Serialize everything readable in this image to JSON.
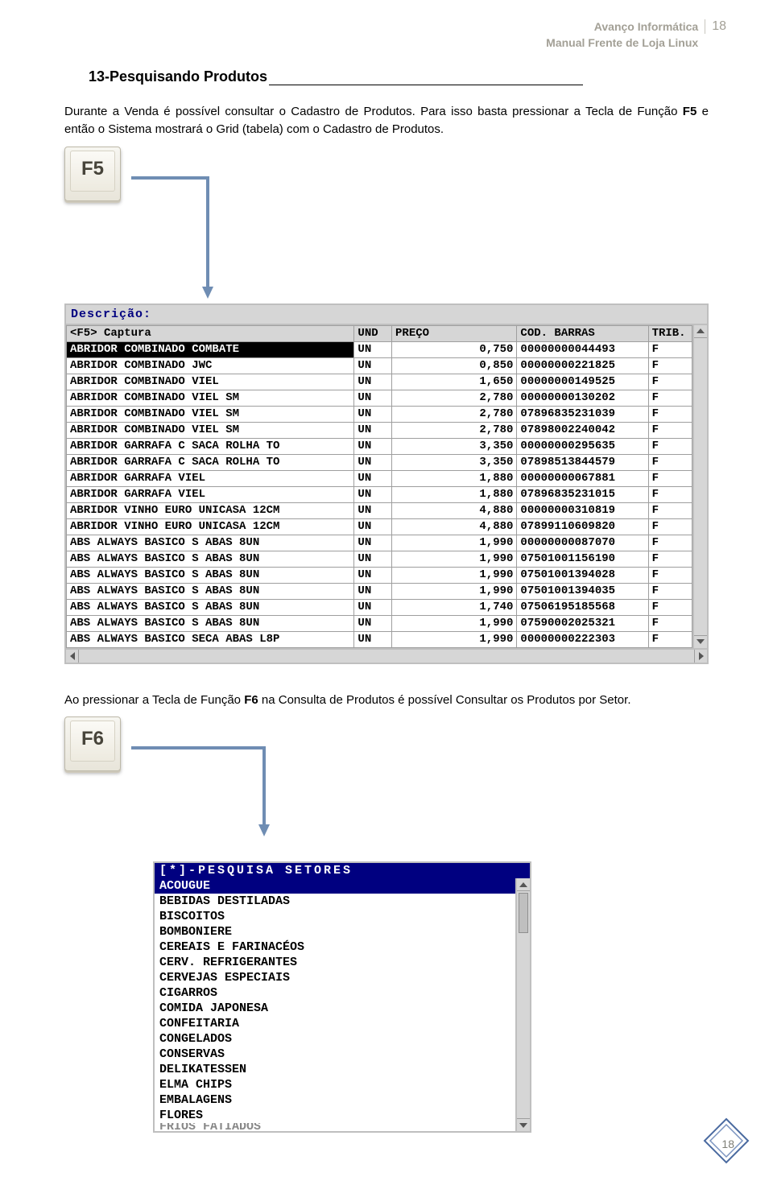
{
  "header": {
    "line1": "Avanço Informática",
    "line2": "Manual Frente de Loja Linux",
    "pagenum_top": "18"
  },
  "section": {
    "num": "13-",
    "title": "Pesquisando Produtos"
  },
  "para1_a": "Durante a Venda é possível consultar o Cadastro de Produtos. Para isso basta pressionar a Tecla de Função ",
  "para1_b": "F5",
  "para1_c": " e então o Sistema mostrará o Grid (tabela) com o Cadastro de Produtos.",
  "key1_label": "F5",
  "grid": {
    "desc_label": "Descrição:",
    "headers": {
      "capture": "<F5> Captura",
      "und": "UND",
      "preco": "PREÇO",
      "barras": "COD. BARRAS",
      "trib": "TRIB."
    },
    "rows": [
      {
        "desc": "ABRIDOR COMBINADO COMBATE",
        "und": "UN",
        "preco": "0,750",
        "barras": "00000000044493",
        "trib": "F"
      },
      {
        "desc": "ABRIDOR COMBINADO JWC",
        "und": "UN",
        "preco": "0,850",
        "barras": "00000000221825",
        "trib": "F"
      },
      {
        "desc": "ABRIDOR COMBINADO VIEL",
        "und": "UN",
        "preco": "1,650",
        "barras": "00000000149525",
        "trib": "F"
      },
      {
        "desc": "ABRIDOR COMBINADO VIEL SM",
        "und": "UN",
        "preco": "2,780",
        "barras": "00000000130202",
        "trib": "F"
      },
      {
        "desc": "ABRIDOR COMBINADO VIEL SM",
        "und": "UN",
        "preco": "2,780",
        "barras": "07896835231039",
        "trib": "F"
      },
      {
        "desc": "ABRIDOR COMBINADO VIEL SM",
        "und": "UN",
        "preco": "2,780",
        "barras": "07898002240042",
        "trib": "F"
      },
      {
        "desc": "ABRIDOR GARRAFA C SACA ROLHA TO",
        "und": "UN",
        "preco": "3,350",
        "barras": "00000000295635",
        "trib": "F"
      },
      {
        "desc": "ABRIDOR GARRAFA C SACA ROLHA TO",
        "und": "UN",
        "preco": "3,350",
        "barras": "07898513844579",
        "trib": "F"
      },
      {
        "desc": "ABRIDOR GARRAFA VIEL",
        "und": "UN",
        "preco": "1,880",
        "barras": "00000000067881",
        "trib": "F"
      },
      {
        "desc": "ABRIDOR GARRAFA VIEL",
        "und": "UN",
        "preco": "1,880",
        "barras": "07896835231015",
        "trib": "F"
      },
      {
        "desc": "ABRIDOR VINHO EURO UNICASA 12CM",
        "und": "UN",
        "preco": "4,880",
        "barras": "00000000310819",
        "trib": "F"
      },
      {
        "desc": "ABRIDOR VINHO EURO UNICASA 12CM",
        "und": "UN",
        "preco": "4,880",
        "barras": "07899110609820",
        "trib": "F"
      },
      {
        "desc": "ABS ALWAYS BASICO S ABAS 8UN",
        "und": "UN",
        "preco": "1,990",
        "barras": "00000000087070",
        "trib": "F"
      },
      {
        "desc": "ABS ALWAYS BASICO S ABAS 8UN",
        "und": "UN",
        "preco": "1,990",
        "barras": "07501001156190",
        "trib": "F"
      },
      {
        "desc": "ABS ALWAYS BASICO S ABAS 8UN",
        "und": "UN",
        "preco": "1,990",
        "barras": "07501001394028",
        "trib": "F"
      },
      {
        "desc": "ABS ALWAYS BASICO S ABAS 8UN",
        "und": "UN",
        "preco": "1,990",
        "barras": "07501001394035",
        "trib": "F"
      },
      {
        "desc": "ABS ALWAYS BASICO S ABAS 8UN",
        "und": "UN",
        "preco": "1,740",
        "barras": "07506195185568",
        "trib": "F"
      },
      {
        "desc": "ABS ALWAYS BASICO S ABAS 8UN",
        "und": "UN",
        "preco": "1,990",
        "barras": "07590002025321",
        "trib": "F"
      },
      {
        "desc": "ABS ALWAYS BASICO SECA ABAS L8P",
        "und": "UN",
        "preco": "1,990",
        "barras": "00000000222303",
        "trib": "F"
      }
    ]
  },
  "para2_a": "Ao pressionar a Tecla de Função ",
  "para2_b": "F6",
  "para2_c": " na Consulta de Produtos é possível Consultar os Produtos por Setor.",
  "key2_label": "F6",
  "setor": {
    "title": "[*]-PESQUISA SETORES",
    "items": [
      "ACOUGUE",
      "BEBIDAS DESTILADAS",
      "BISCOITOS",
      "BOMBONIERE",
      "CEREAIS E FARINACÉOS",
      "CERV. REFRIGERANTES",
      "CERVEJAS ESPECIAIS",
      "CIGARROS",
      "COMIDA JAPONESA",
      "CONFEITARIA",
      "CONGELADOS",
      "CONSERVAS",
      "DELIKATESSEN",
      "ELMA CHIPS",
      "EMBALAGENS",
      "FLORES"
    ],
    "cut_item": "FRIOS FATIADOS"
  },
  "footer_pagenum": "18"
}
